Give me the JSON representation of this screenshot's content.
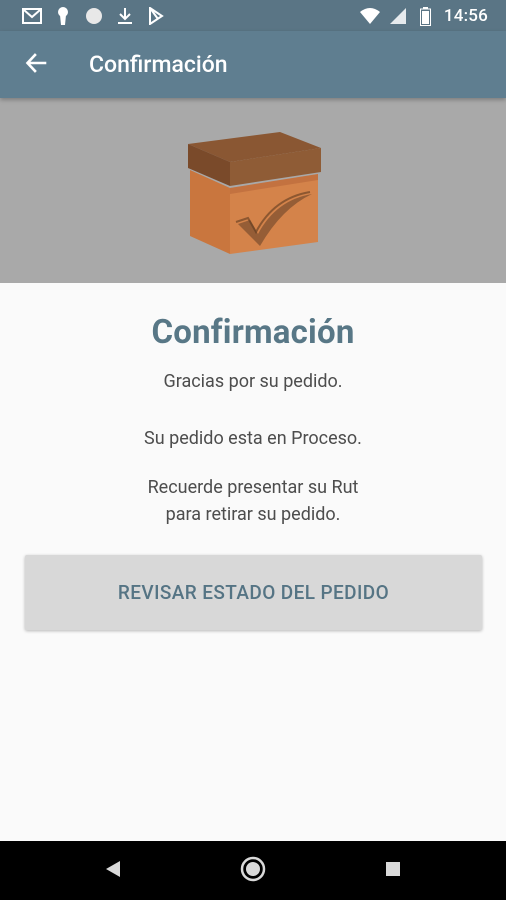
{
  "status_bar": {
    "time": "14:56",
    "icons": [
      "gmail-icon",
      "keyhole-icon",
      "circle-icon",
      "download-icon",
      "play-store-icon",
      "wifi-icon",
      "signal-icon",
      "battery-icon"
    ]
  },
  "app_bar": {
    "title": "Confirmación",
    "back_icon": "arrow-back-icon"
  },
  "hero": {
    "image": "box-checkmark-illustration"
  },
  "content": {
    "heading": "Confirmación",
    "line1": "Gracias por su pedido.",
    "line2": "Su pedido esta en Proceso.",
    "line3": "Recuerde presentar su Rut",
    "line4": "para retirar su pedido.",
    "button_label": "REVISAR ESTADO DEL PEDIDO"
  },
  "nav_bar": {
    "back": "nav-back-icon",
    "home": "nav-home-icon",
    "recents": "nav-recents-icon"
  },
  "colors": {
    "appbar": "#5f7e90",
    "statusbar": "#5a7585",
    "heading": "#587786",
    "hero_bg": "#a9a9a9",
    "button_bg": "#d8d8d8"
  }
}
